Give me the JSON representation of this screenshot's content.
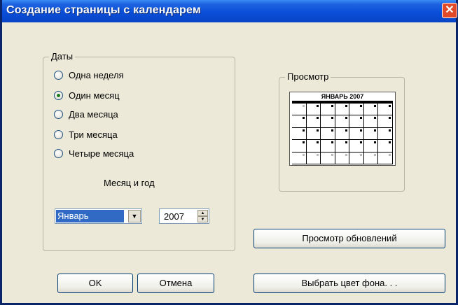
{
  "dialog": {
    "title": "Создание страницы с календарем",
    "close_symbol": "✕"
  },
  "dates": {
    "legend": "Даты",
    "options": [
      {
        "label": "Одна неделя",
        "checked": false
      },
      {
        "label": "Один месяц",
        "checked": true
      },
      {
        "label": "Два месяца",
        "checked": false
      },
      {
        "label": "Три месяца",
        "checked": false
      },
      {
        "label": "Четыре месяца",
        "checked": false
      }
    ],
    "month_year_label": "Месяц и год",
    "month_value": "Январь",
    "year_value": "2007"
  },
  "preview": {
    "legend": "Просмотр",
    "calendar_title": "ЯНВАРЬ 2007"
  },
  "buttons": {
    "ok": "OK",
    "cancel": "Отмена",
    "preview_updates": "Просмотр обновлений",
    "choose_bg_color": "Выбрать цвет фона. . ."
  },
  "icons": {
    "close": "close-icon",
    "combo_arrow": "chevron-down-icon",
    "spin_up": "arrow-up-icon",
    "spin_down": "arrow-down-icon"
  }
}
